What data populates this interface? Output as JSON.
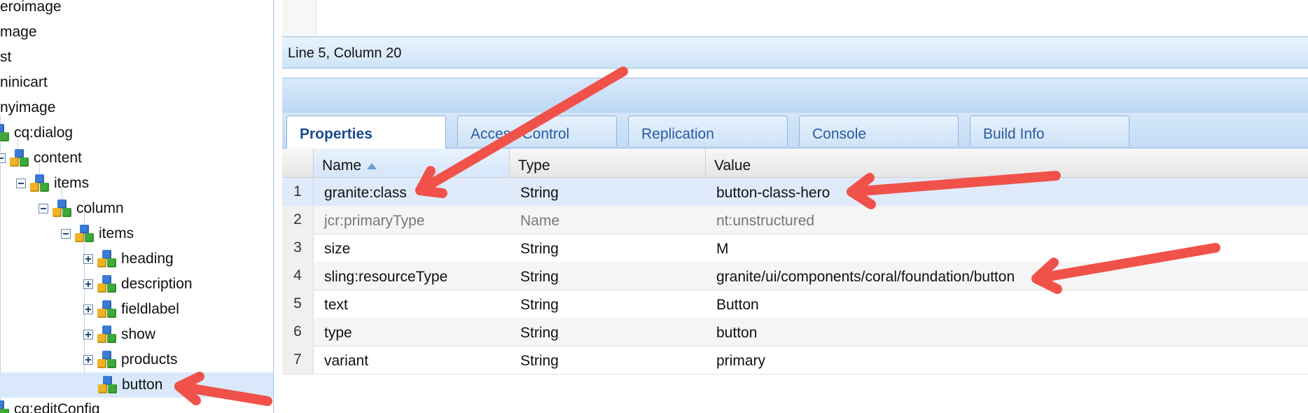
{
  "tree": {
    "items": [
      {
        "label": "eroimage"
      },
      {
        "label": "mage"
      },
      {
        "label": "st"
      },
      {
        "label": "ninicart"
      },
      {
        "label": "nyimage"
      },
      {
        "label": "cq:dialog"
      },
      {
        "label": "content"
      },
      {
        "label": "items"
      },
      {
        "label": "column"
      },
      {
        "label": "items"
      },
      {
        "label": "heading"
      },
      {
        "label": "description"
      },
      {
        "label": "fieldlabel"
      },
      {
        "label": "show"
      },
      {
        "label": "products"
      },
      {
        "label": "button"
      },
      {
        "label": "cq:editConfig"
      }
    ]
  },
  "status": {
    "cursor": "Line 5, Column 20"
  },
  "tabs": [
    "Properties",
    "Access Control",
    "Replication",
    "Console",
    "Build Info"
  ],
  "grid": {
    "columns": [
      "Name",
      "Type",
      "Value"
    ],
    "rows": [
      {
        "n": "1",
        "name": "granite:class",
        "type": "String",
        "value": "button-class-hero"
      },
      {
        "n": "2",
        "name": "jcr:primaryType",
        "type": "Name",
        "value": "nt:unstructured"
      },
      {
        "n": "3",
        "name": "size",
        "type": "String",
        "value": "M"
      },
      {
        "n": "4",
        "name": "sling:resourceType",
        "type": "String",
        "value": "granite/ui/components/coral/foundation/button"
      },
      {
        "n": "5",
        "name": "text",
        "type": "String",
        "value": "Button"
      },
      {
        "n": "6",
        "name": "type",
        "type": "String",
        "value": "button"
      },
      {
        "n": "7",
        "name": "variant",
        "type": "String",
        "value": "primary"
      }
    ]
  },
  "colors": {
    "arrow": "#f0524a",
    "selection": "#dfeafa",
    "panel_blue": "#cfe3f8",
    "tab_text": "#2b5aa0"
  },
  "icons": [
    "cubes-node-icon",
    "expand-plus-icon",
    "collapse-minus-icon",
    "sort-asc-icon"
  ]
}
